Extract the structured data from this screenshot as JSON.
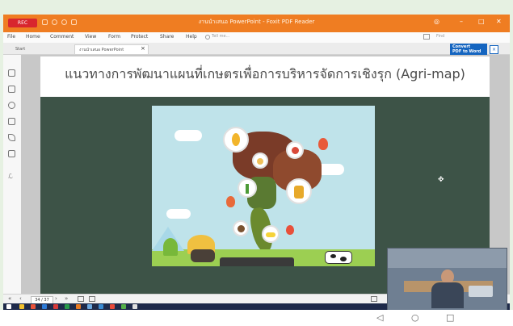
{
  "window": {
    "title": "งานนำเสนอ PowerPoint - Foxit PDF Reader",
    "rec_label": "REC"
  },
  "menu": {
    "items": [
      "File",
      "Home",
      "Comment",
      "View",
      "Form",
      "Protect",
      "Share",
      "Help"
    ],
    "tell_me": "Tell me...",
    "find": "Find"
  },
  "tabs": {
    "start": "Start",
    "document": "งานนำเสนอ PowerPoint",
    "close": "×"
  },
  "convert": {
    "line1": "Convert",
    "line2": "PDF to Word"
  },
  "slide": {
    "title": "แนวทางการพัฒนาแผนที่เกษตรเพื่อการบริหารจัดการเชิงรุก (Agri-map)"
  },
  "status": {
    "page": "34 / 37"
  },
  "android_nav": {
    "back": "◁",
    "home": "○",
    "recents": "□"
  }
}
